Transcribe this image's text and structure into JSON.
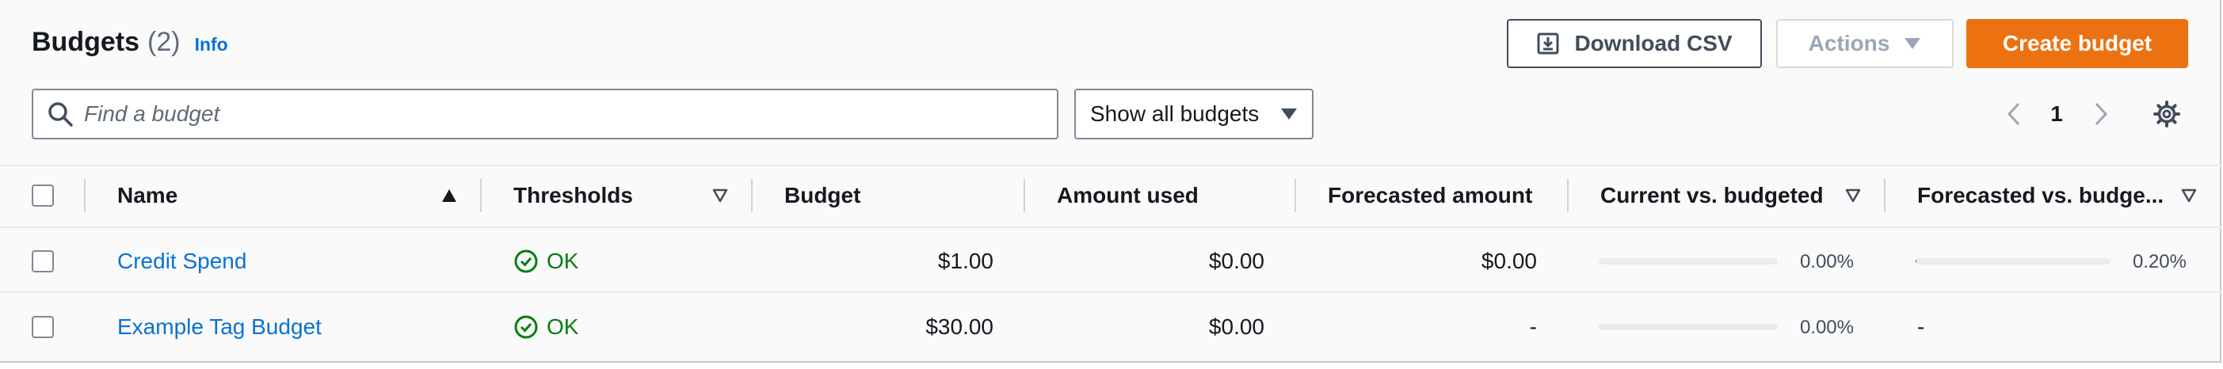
{
  "header": {
    "title": "Budgets",
    "count": "(2)",
    "info_label": "Info",
    "download_csv_label": "Download CSV",
    "actions_label": "Actions",
    "create_label": "Create budget"
  },
  "filter": {
    "search_placeholder": "Find a budget",
    "select_value": "Show all budgets"
  },
  "pagination": {
    "current_page": "1"
  },
  "table": {
    "columns": {
      "name": "Name",
      "thresholds": "Thresholds",
      "budget": "Budget",
      "amount_used": "Amount used",
      "forecasted_amount": "Forecasted amount",
      "current_vs_budgeted": "Current vs. budgeted",
      "forecasted_vs_budgeted": "Forecasted vs. budge..."
    },
    "rows": [
      {
        "name": "Credit Spend",
        "threshold": "OK",
        "budget": "$1.00",
        "amount_used": "$0.00",
        "forecasted_amount": "$0.00",
        "current_vs_budgeted": "0.00%",
        "current_vs_budgeted_fraction": 0.0,
        "forecasted_vs_budgeted": "0.20%",
        "forecasted_vs_budgeted_fraction": 0.002
      },
      {
        "name": "Example Tag Budget",
        "threshold": "OK",
        "budget": "$30.00",
        "amount_used": "$0.00",
        "forecasted_amount": "-",
        "current_vs_budgeted": "0.00%",
        "current_vs_budgeted_fraction": 0.0,
        "forecasted_vs_budgeted": "-"
      }
    ]
  },
  "icons": {
    "search": "search-icon",
    "download": "download-icon",
    "dropdown": "caret-down-icon",
    "prev": "chevron-left-icon",
    "next": "chevron-right-icon",
    "settings": "gear-icon",
    "sort_asc": "sort-ascending-icon",
    "sort_none": "sort-descending-icon",
    "status_ok": "status-ok-icon"
  },
  "colors": {
    "primary": "#ec7211",
    "link": "#0972d3",
    "success": "#037f0c"
  }
}
